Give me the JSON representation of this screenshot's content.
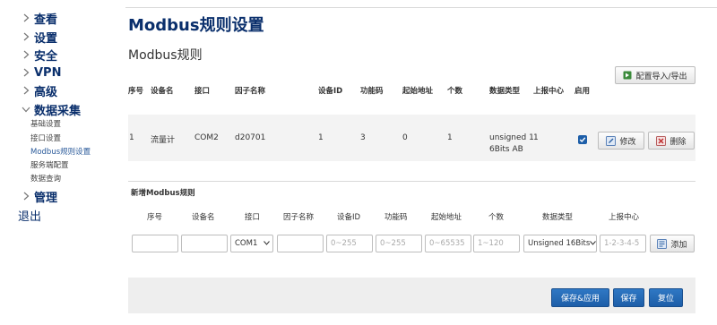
{
  "sidebar": {
    "items": [
      {
        "label": "查看"
      },
      {
        "label": "设置"
      },
      {
        "label": "安全"
      },
      {
        "label": "VPN"
      },
      {
        "label": "高级"
      },
      {
        "label": "数据采集"
      }
    ],
    "subitems": [
      {
        "label": "基础设置"
      },
      {
        "label": "接口设置"
      },
      {
        "label": "Modbus规则设置"
      },
      {
        "label": "服务端配置"
      },
      {
        "label": "数据查询"
      }
    ],
    "manage": {
      "label": "管理"
    },
    "logout": "退出"
  },
  "page": {
    "title": "Modbus规则设置",
    "section_title": "Modbus规则",
    "import_export_label": "配置导入/导出"
  },
  "table": {
    "headers": [
      "序号",
      "设备名",
      "接口",
      "因子名称",
      "设备ID",
      "功能码",
      "起始地址",
      "个数",
      "数据类型",
      "上报中心",
      "启用"
    ],
    "rows": [
      {
        "index": "1",
        "device": "流量计",
        "port": "COM2",
        "factor": "d20701",
        "device_id": "1",
        "func": "3",
        "start": "0",
        "count": "1",
        "type_line1": "unsigned 1",
        "type_line2": "6Bits AB",
        "center": "1",
        "enabled": true,
        "edit_label": "修改",
        "delete_label": "删除"
      }
    ]
  },
  "new_rule": {
    "title": "新增Modbus规则",
    "headers": [
      "序号",
      "设备名",
      "接口",
      "因子名称",
      "设备ID",
      "功能码",
      "起始地址",
      "个数",
      "数据类型",
      "上报中心"
    ],
    "port_value": "COM1",
    "device_id_placeholder": "0~255",
    "func_placeholder": "0~255",
    "start_placeholder": "0~65535",
    "count_placeholder": "1~120",
    "type_value": "Unsigned 16Bits",
    "center_placeholder": "1-2-3-4-5",
    "add_label": "添加"
  },
  "footer": {
    "save_apply": "保存&应用",
    "save": "保存",
    "reset": "复位"
  },
  "colors": {
    "nav_text": "#0a2f6c",
    "primary_button": "#1d5ea8"
  }
}
